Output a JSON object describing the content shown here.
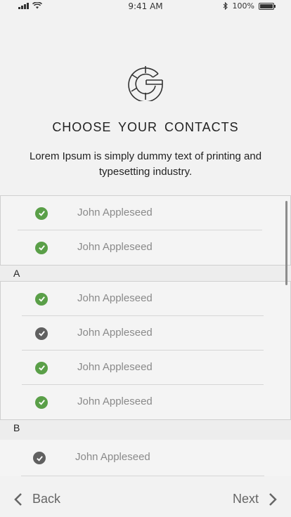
{
  "status_bar": {
    "time": "9:41 AM",
    "battery": "100%"
  },
  "header": {
    "title": "CHOOSE  YOUR  CONTACTS",
    "description": "Lorem Ipsum is simply dummy text of printing and typesetting industry."
  },
  "contacts": {
    "group0": [
      {
        "name": "John Appleseed",
        "status": "selected"
      },
      {
        "name": "John Appleseed",
        "status": "selected"
      }
    ],
    "section_a": "A",
    "groupA": [
      {
        "name": "John Appleseed",
        "status": "selected"
      },
      {
        "name": "John Appleseed",
        "status": "unselected"
      },
      {
        "name": "John Appleseed",
        "status": "selected"
      },
      {
        "name": "John Appleseed",
        "status": "selected"
      }
    ],
    "section_b": "B",
    "groupB": [
      {
        "name": "John Appleseed",
        "status": "unselected"
      }
    ]
  },
  "footer": {
    "back_label": "Back",
    "next_label": "Next"
  },
  "colors": {
    "selected_check": "#5a9f48",
    "unselected_check": "#606060",
    "background": "#f2f2f2"
  }
}
